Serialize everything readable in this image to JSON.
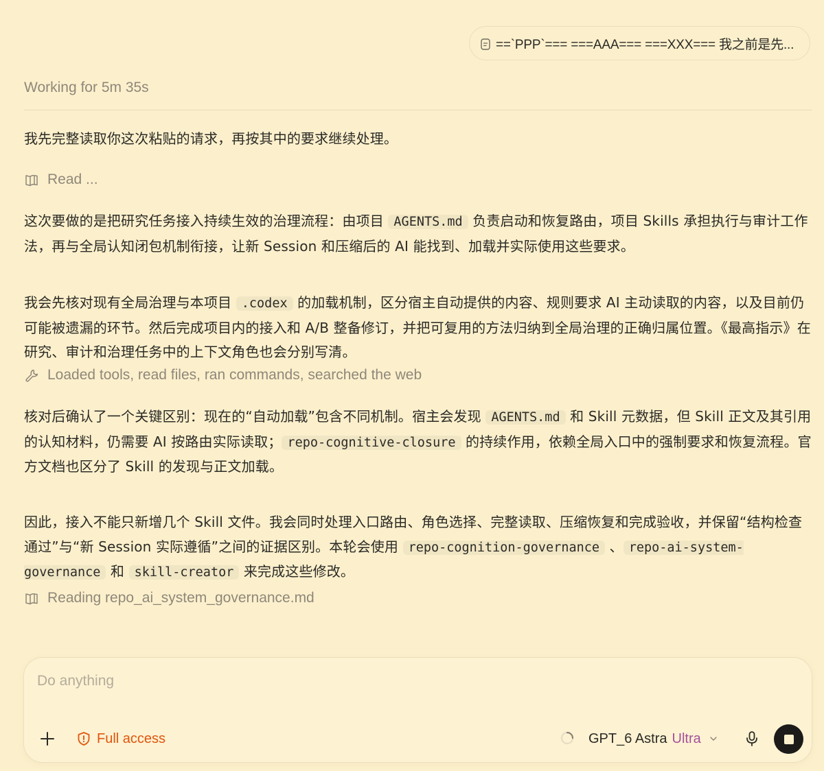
{
  "user_message": {
    "preview": "==`PPP`=== ===AAA=== ===XXX=== 我之前是先..."
  },
  "status": {
    "working": "Working for 5m 35s"
  },
  "transcript": {
    "p1": "我先完整读取你这次粘贴的请求，再按其中的要求继续处理。",
    "action1": "Read ...",
    "p2": {
      "t1": "这次要做的是把研究任务接入持续生效的治理流程：由项目 ",
      "c1": "AGENTS.md",
      "t2": " 负责启动和恢复路由，项目 Skills 承担执行与审计工作法，再与全局认知闭包机制衔接，让新 Session 和压缩后的 AI 能找到、加载并实际使用这些要求。"
    },
    "p3": {
      "t1": "我会先核对现有全局治理与本项目 ",
      "c1": ".codex",
      "t2": " 的加载机制，区分宿主自动提供的内容、规则要求 AI 主动读取的内容，以及目前仍可能被遗漏的环节。然后完成项目内的接入和 A/B 整备修订，并把可复用的方法归纳到全局治理的正确归属位置。《最高指示》在研究、审计和治理任务中的上下文角色也会分别写清。"
    },
    "action2": "Loaded tools, read files, ran commands, searched the web",
    "p4": {
      "t1": "核对后确认了一个关键区别：现在的“自动加载”包含不同机制。宿主会发现 ",
      "c1": "AGENTS.md",
      "t2": " 和 Skill 元数据，但 Skill 正文及其引用的认知材料，仍需要 AI 按路由实际读取；",
      "c2": "repo-cognitive-closure",
      "t3": " 的持续作用，依赖全局入口中的强制要求和恢复流程。官方文档也区分了 Skill 的发现与正文加载。"
    },
    "p5": {
      "t1": "因此，接入不能只新增几个 Skill 文件。我会同时处理入口路由、角色选择、完整读取、压缩恢复和完成验收，并保留“结构检查通过”与“新 Session 实际遵循”之间的证据区别。本轮会使用 ",
      "c1": "repo-cognition-governance",
      "t2": " 、",
      "c2": "repo-ai-system-governance",
      "t3": " 和 ",
      "c3": "skill-creator",
      "t4": " 来完成这些修改。"
    },
    "action3": "Reading repo_ai_system_governance.md"
  },
  "composer": {
    "placeholder": "Do anything",
    "access_label": "Full access",
    "model_name": "GPT_6 Astra",
    "model_variant": "Ultra"
  },
  "colors": {
    "background": "#fcf0cc",
    "access": "#e0560e",
    "variant": "#a3519a",
    "muted": "#8f877a"
  },
  "icons": {
    "chip": "document-icon",
    "read": "book-open-icon",
    "tools": "wrench-icon",
    "plus": "plus-icon",
    "access": "alert-shield-icon",
    "spinner": "loading-spinner-icon",
    "model": "chevron-down-icon",
    "mic": "microphone-icon",
    "stop": "stop-icon"
  }
}
